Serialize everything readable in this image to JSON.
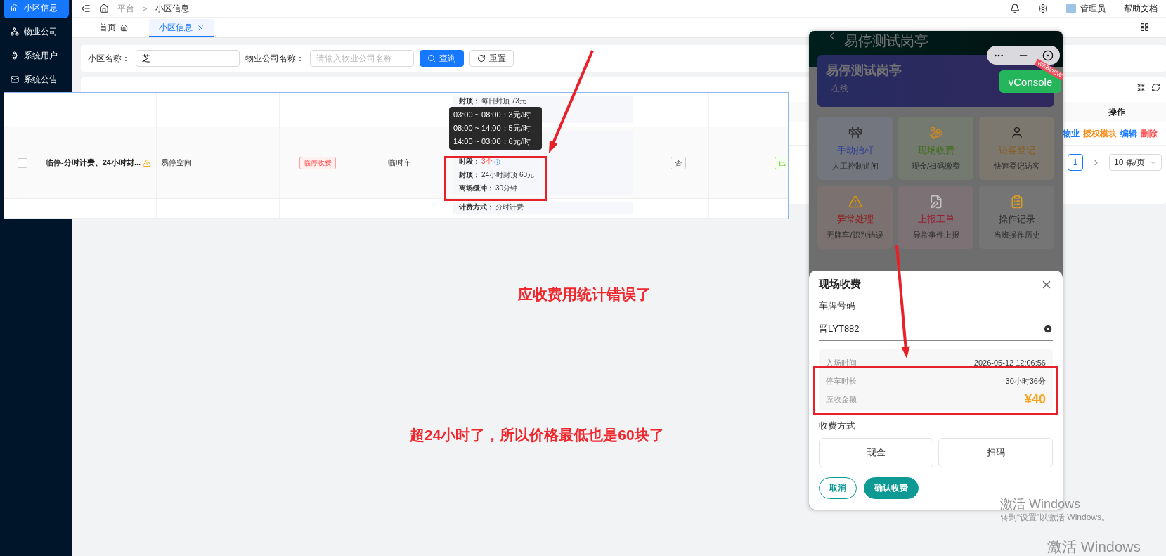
{
  "sidebar": {
    "items": [
      {
        "label": "小区信息",
        "selected": true
      },
      {
        "label": "物业公司",
        "selected": false
      },
      {
        "label": "系统用户",
        "selected": false
      },
      {
        "label": "系统公告",
        "selected": false
      }
    ]
  },
  "header": {
    "breadcrumb": [
      "平台",
      "小区信息"
    ],
    "separator": ">",
    "user": "管理员",
    "help": "帮助文档"
  },
  "tabs": [
    {
      "label": "首页",
      "selected": false,
      "kind": "home"
    },
    {
      "label": "小区信息",
      "selected": true,
      "kind": "closable"
    }
  ],
  "search": {
    "fields": [
      {
        "label": "小区名称：",
        "value": "芝"
      },
      {
        "label": "物业公司名称：",
        "placeholder": "请输入物业公司名称"
      }
    ],
    "buttons": [
      {
        "label": "查询",
        "kind": "primary"
      },
      {
        "label": "重置",
        "kind": "default"
      }
    ]
  },
  "table": {
    "action_header": "操作",
    "actions": [
      {
        "label": "物业",
        "color": "#1677ff"
      },
      {
        "label": "授权模块",
        "color": "#fa8c16"
      },
      {
        "label": "编辑",
        "color": "#1677ff"
      },
      {
        "label": "删除",
        "color": "#ff4d4f"
      }
    ],
    "pagination": {
      "page": "1",
      "page_size": "10 条/页"
    }
  },
  "snippet": {
    "rows": [
      {
        "kind": "partial",
        "rule": [
          {
            "label": "封顶：",
            "value": "每日封顶 73元"
          }
        ]
      },
      {
        "kind": "full",
        "checked": false,
        "name": "临停-分时计费、24小时封...",
        "warning": true,
        "company": "易停空间",
        "charge_tag": "临停收费",
        "car_type": "临时车",
        "rule": [
          {
            "label": "时段：",
            "value": "3个",
            "kind": "count"
          },
          {
            "label": "封顶：",
            "value": "24小时封顶 60元"
          },
          {
            "label": "离场缓冲：",
            "value": "30分钟"
          }
        ],
        "flag": "否",
        "column_8": "-",
        "status": "已"
      },
      {
        "kind": "partial",
        "rule": [
          {
            "label": "计费方式：",
            "value": "分时计费"
          }
        ]
      }
    ],
    "tooltip": [
      "03:00 ~ 08:00：3元/时",
      "08:00 ~ 14:00：5元/时",
      "14:00 ~ 03:00：6元/时"
    ]
  },
  "phone": {
    "title": "易停测试岗亭",
    "card_title": "易停测试岗亭",
    "card_status": "在线",
    "vconsole": "vConsole",
    "ribbon": "WEBVIEW",
    "grid": [
      {
        "title": "手动抬杆",
        "subtitle": "人工控制道闸",
        "color": "#2f3f96"
      },
      {
        "title": "现场收费",
        "subtitle": "现金/扫码缴费",
        "color": "#3f6e18"
      },
      {
        "title": "访客登记",
        "subtitle": "快速登记访客",
        "color": "#8a5a16"
      },
      {
        "title": "异常处理",
        "subtitle": "无牌车/识别错误",
        "color": "#8e1e1e"
      },
      {
        "title": "上报工单",
        "subtitle": "异常事件上报",
        "color": "#9a1e34"
      },
      {
        "title": "操作记录",
        "subtitle": "当班操作历史",
        "color": "#2a2a2a"
      }
    ],
    "modal": {
      "title": "现场收费",
      "plate_label": "车牌号码",
      "plate_value": "晋LYT882",
      "info": [
        {
          "label": "入场时间",
          "value": "2026-05-12 12:06:56",
          "kind": "text"
        },
        {
          "label": "停车时长",
          "value": "30小时36分",
          "kind": "text"
        },
        {
          "label": "应收金额",
          "value": "¥40",
          "kind": "amount"
        }
      ],
      "pay_label": "收费方式",
      "pay_options": [
        "现金",
        "扫码"
      ],
      "buttons": [
        {
          "label": "取消",
          "kind": "outline"
        },
        {
          "label": "确认收费",
          "kind": "primary"
        }
      ]
    }
  },
  "annotations": {
    "notes": [
      "应收费用统计错误了",
      "超24小时了，所以价格最低也是60块了"
    ]
  },
  "os_watermark": {
    "title": "激活 Windows",
    "hint": "转到“设置”以激活 Windows。",
    "title_2": "激活 Windows"
  }
}
